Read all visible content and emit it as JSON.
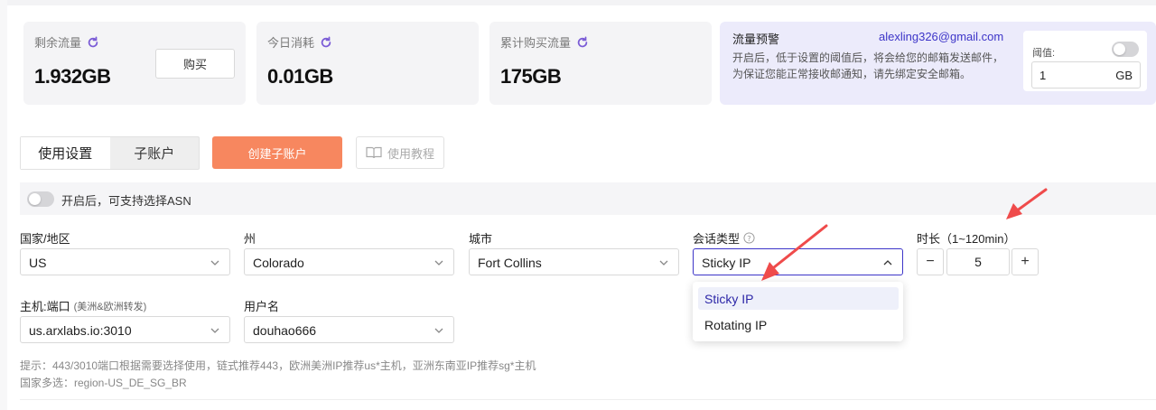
{
  "stats": {
    "remaining": {
      "label": "剩余流量",
      "value": "1.932GB",
      "buy_label": "购买"
    },
    "today": {
      "label": "今日消耗",
      "value": "0.01GB"
    },
    "total": {
      "label": "累计购买流量",
      "value": "175GB"
    }
  },
  "warning": {
    "title": "流量预警",
    "email": "alexling326@gmail.com",
    "description": "开启后，低于设置的阈值后，将会给您的邮箱发送邮件，为保证您能正常接收邮通知，请先绑定安全邮箱。",
    "threshold_label": "阈值:",
    "threshold_value": "1",
    "threshold_unit": "GB"
  },
  "tabs": [
    {
      "label": "使用设置"
    },
    {
      "label": "子账户"
    }
  ],
  "actions": {
    "create_sub": "创建子账户",
    "guide": "使用教程"
  },
  "asn": {
    "label": "开启后，可支持选择ASN"
  },
  "form": {
    "country": {
      "label": "国家/地区",
      "value": "US"
    },
    "state": {
      "label": "州",
      "value": "Colorado"
    },
    "city": {
      "label": "城市",
      "value": "Fort Collins"
    },
    "session": {
      "label": "会话类型",
      "value": "Sticky IP",
      "options": [
        "Sticky IP",
        "Rotating IP"
      ]
    },
    "duration": {
      "label": "时长（1~120min）",
      "value": "5",
      "minus": "−",
      "plus": "+"
    },
    "host": {
      "label": "主机:端口",
      "sub": "(美洲&欧洲转发)",
      "value": "us.arxlabs.io:3010"
    },
    "username": {
      "label": "用户名",
      "value": "douhao666"
    }
  },
  "hints": {
    "line1": "提示：443/3010端口根据需要选择使用，链式推荐443，欧洲美洲IP推荐us*主机，亚洲东南亚IP推荐sg*主机",
    "line2": "国家多选：region-US_DE_SG_BR"
  },
  "colors": {
    "accent": "#3d35c8",
    "create_button": "#f7875f",
    "annotation_arrow": "#ef4b4b"
  }
}
